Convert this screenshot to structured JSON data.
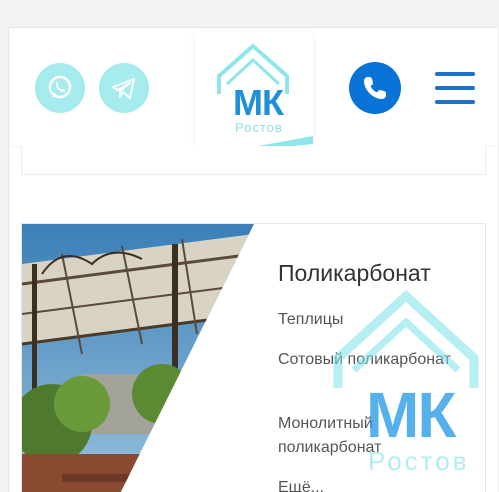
{
  "header": {
    "logo": {
      "text": "МК",
      "subtitle": "Ростов"
    },
    "icons": {
      "whatsapp": "whatsapp-icon",
      "telegram": "telegram-icon",
      "phone": "phone-icon",
      "menu": "hamburger-menu-icon"
    }
  },
  "category_card": {
    "title": "Поликарбонат",
    "links": [
      "Теплицы",
      "Сотовый поликарбонат",
      "Монолитный поликарбонат",
      "Ещё..."
    ]
  },
  "watermark": {
    "text": "МК",
    "subtitle": "Ростов"
  },
  "colors": {
    "accent_light": "#a6ecef",
    "accent_blue": "#0a73d8",
    "logo_blue": "#1f8fd9"
  }
}
